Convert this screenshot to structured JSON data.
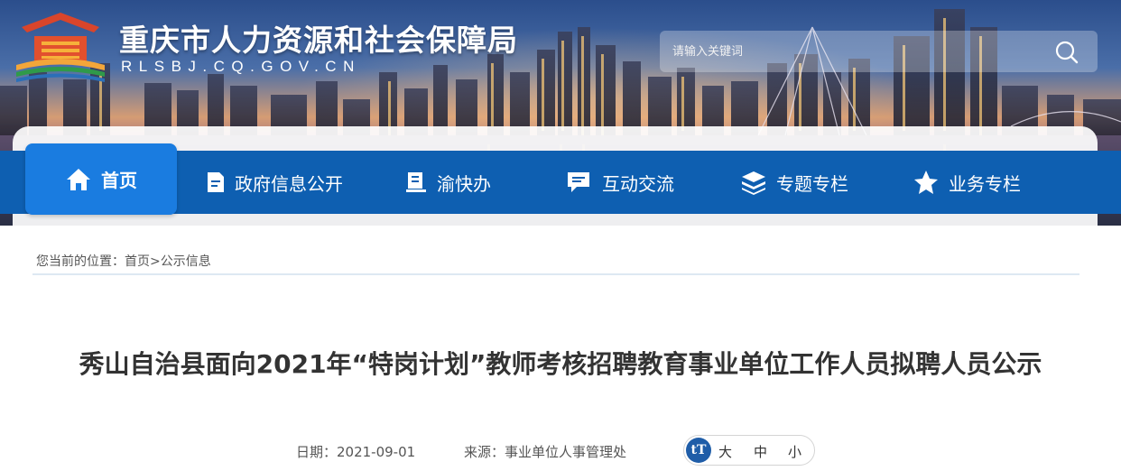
{
  "header": {
    "site_title": "重庆市人力资源和社会保障局",
    "site_domain": "RLSBJ.CQ.GOV.CN",
    "search_placeholder": "请输入关键词"
  },
  "nav": {
    "items": [
      {
        "label": "首页",
        "icon": "home-icon",
        "active": true
      },
      {
        "label": "政府信息公开",
        "icon": "document-icon"
      },
      {
        "label": "渝快办",
        "icon": "book-icon"
      },
      {
        "label": "互动交流",
        "icon": "chat-icon"
      },
      {
        "label": "专题专栏",
        "icon": "layers-icon"
      },
      {
        "label": "业务专栏",
        "icon": "star-icon"
      }
    ]
  },
  "breadcrumb": {
    "prefix": "您当前的位置：",
    "home": "首页",
    "separator": ">",
    "current": "公示信息"
  },
  "article": {
    "title": "秀山自治县面向2021年“特岗计划”教师考核招聘教育事业单位工作人员拟聘人员公示",
    "date": "日期：2021-09-01",
    "source": "来源：事业单位人事管理处",
    "font_size_icon": "tT",
    "font_large": "大",
    "font_medium": "中",
    "font_small": "小"
  },
  "colors": {
    "nav_bg": "#0e5fb1",
    "nav_active": "#1a7ce0",
    "accent": "#1f5da8"
  }
}
